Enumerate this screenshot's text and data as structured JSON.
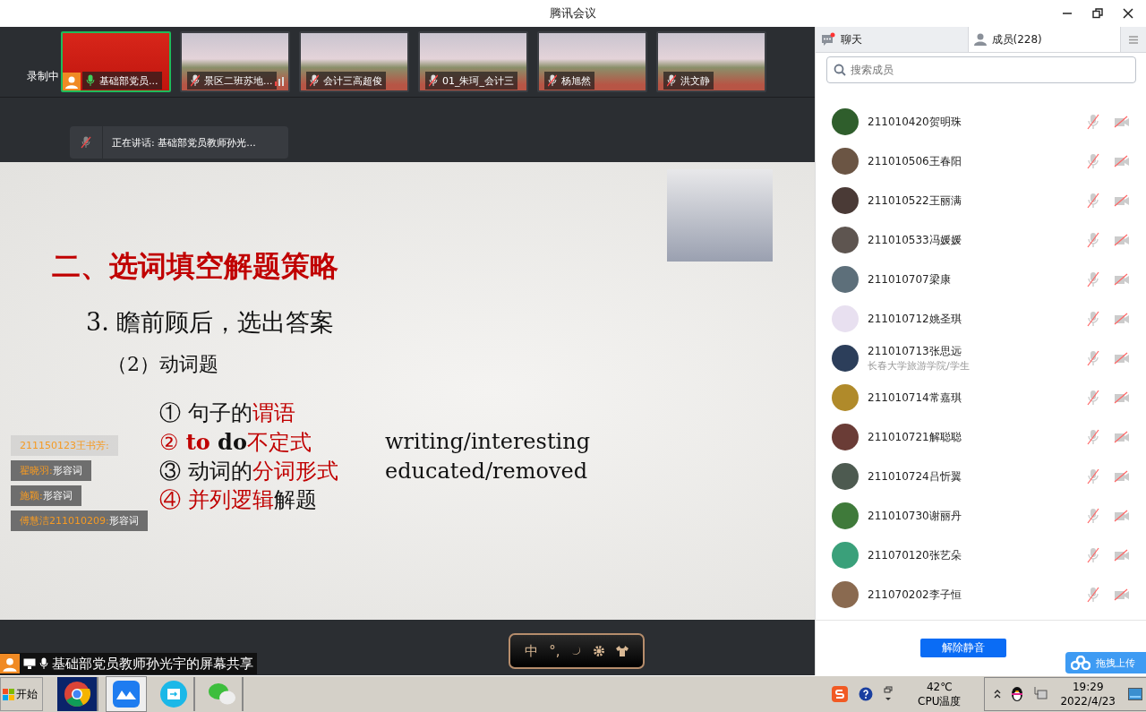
{
  "window": {
    "title": "腾讯会议"
  },
  "recording": {
    "label": "录制中"
  },
  "video_tiles": [
    {
      "name": "基础部党员...",
      "selected": true,
      "mic_on": true,
      "signal": false
    },
    {
      "name": "景区二班苏地...",
      "selected": false,
      "mic_on": false,
      "signal": true
    },
    {
      "name": "会计三高超俊",
      "selected": false,
      "mic_on": false,
      "signal": false
    },
    {
      "name": "01_朱珂_会计三",
      "selected": false,
      "mic_on": false,
      "signal": false
    },
    {
      "name": "杨旭然",
      "selected": false,
      "mic_on": false,
      "signal": false
    },
    {
      "name": "洪文静",
      "selected": false,
      "mic_on": false,
      "signal": false
    }
  ],
  "speaking": {
    "text": "正在讲话: 基础部党员教师孙光..."
  },
  "slide": {
    "heading": "二、选词填空解题策略",
    "subheading": "3. 瞻前顾后，选出答案",
    "section": "（2）动词题",
    "items": [
      {
        "marker": "①",
        "marker_red": false,
        "parts": [
          {
            "text": "句子的",
            "red": false,
            "bold": false
          },
          {
            "text": "谓语",
            "red": true,
            "bold": false
          }
        ]
      },
      {
        "marker": "②",
        "marker_red": true,
        "parts": [
          {
            "text": "to ",
            "red": true,
            "bold": true
          },
          {
            "text": "do",
            "red": false,
            "bold": true
          },
          {
            "text": "不定式",
            "red": true,
            "bold": false
          }
        ],
        "example": "writing/interesting"
      },
      {
        "marker": "③",
        "marker_red": false,
        "parts": [
          {
            "text": "动词的",
            "red": false,
            "bold": false
          },
          {
            "text": "分词形式",
            "red": true,
            "bold": false
          }
        ],
        "example": "educated/removed"
      },
      {
        "marker": "④",
        "marker_red": true,
        "parts": [
          {
            "text": "并列逻辑",
            "red": true,
            "bold": false
          },
          {
            "text": "解题",
            "red": false,
            "bold": false
          }
        ]
      }
    ]
  },
  "chat_overlay": [
    {
      "name": "211150123王书芳:",
      "faded": true
    },
    {
      "name": "翟晓羽:",
      "message": "形容词",
      "faded": false
    },
    {
      "name": "施颖:",
      "message": "形容词",
      "faded": false
    },
    {
      "name": "傅慧洁211010209:",
      "message": "形容词",
      "faded": false
    }
  ],
  "share_label": {
    "text": "基础部党员教师孙光宇的屏幕共享"
  },
  "ime_toolbar": {
    "mode": "中",
    "punctuation": "°,"
  },
  "panel_tabs": [
    {
      "label": "聊天",
      "selected": false,
      "unread": true
    },
    {
      "label": "成员(228)",
      "selected": true,
      "unread": false
    }
  ],
  "search": {
    "placeholder": "搜索成员"
  },
  "members": [
    {
      "name": "211010420贺明珠",
      "color": "#2f5e2c",
      "mic_muted": true,
      "cam_muted": true
    },
    {
      "name": "211010506王春阳",
      "color": "#6b5544",
      "mic_muted": true,
      "cam_muted": true
    },
    {
      "name": "211010522王丽满",
      "color": "#4a3a36",
      "mic_muted": true,
      "cam_muted": true
    },
    {
      "name": "211010533冯媛媛",
      "color": "#5e5550",
      "mic_muted": true,
      "cam_muted": true
    },
    {
      "name": "211010707梁康",
      "color": "#5d6f7a",
      "mic_muted": true,
      "cam_muted": true
    },
    {
      "name": "211010712姚圣琪",
      "color": "#e8e0f0",
      "mic_muted": true,
      "cam_muted": true
    },
    {
      "name": "211010713张思远",
      "subtitle": "长春大学旅游学院/学生",
      "color": "#2c3e5a",
      "mic_muted": true,
      "cam_muted": true
    },
    {
      "name": "211010714常嘉琪",
      "color": "#b08a2a",
      "mic_muted": true,
      "cam_muted": true
    },
    {
      "name": "211010721解聪聪",
      "color": "#6a3c36",
      "mic_muted": true,
      "cam_muted": true
    },
    {
      "name": "211010724吕忻翼",
      "color": "#4d5a50",
      "mic_muted": true,
      "cam_muted": true
    },
    {
      "name": "211010730谢丽丹",
      "color": "#3f7a3a",
      "mic_muted": true,
      "cam_muted": true
    },
    {
      "name": "211070120张艺朵",
      "color": "#3aa07a",
      "mic_muted": true,
      "cam_muted": true
    },
    {
      "name": "211070202李子恒",
      "color": "#8a6a50",
      "mic_muted": true,
      "cam_muted": true
    }
  ],
  "unmute_button": {
    "label": "解除静音"
  },
  "upload_badge": {
    "label": "拖拽上传"
  },
  "taskbar": {
    "start": "开始",
    "temperature": "42℃",
    "temperature_label": "CPU温度",
    "time": "19:29",
    "date": "2022/4/23"
  }
}
